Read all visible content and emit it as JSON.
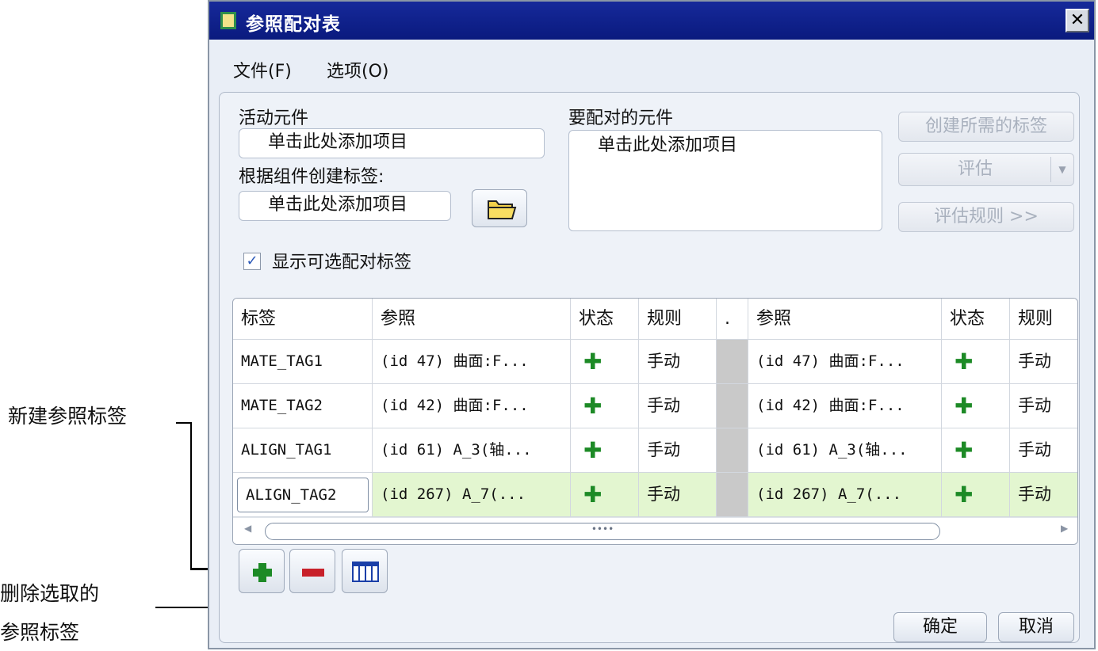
{
  "annotations": {
    "new_tag": "新建参照标签",
    "delete_line1": "删除选取的",
    "delete_line2": "参照标签"
  },
  "dialog": {
    "title": "参照配对表",
    "close_glyph": "✕"
  },
  "menu": {
    "file": "文件(F)",
    "options": "选项(O)"
  },
  "form": {
    "active_component_label": "活动元件",
    "active_component_placeholder": "单击此处添加项目",
    "by_component_label": "根据组件创建标签:",
    "by_component_placeholder": "单击此处添加项目",
    "to_pair_label": "要配对的元件",
    "to_pair_placeholder": "单击此处添加项目",
    "show_optional_label": "显示可选配对标签",
    "show_optional_checked": true
  },
  "side_buttons": {
    "create_tags": "创建所需的标签",
    "evaluate": "评估",
    "evaluate_rules": "评估规则 >>"
  },
  "table": {
    "headers": [
      "标签",
      "参照",
      "状态",
      "规则",
      ".",
      "参照",
      "状态",
      "规则"
    ],
    "rows": [
      {
        "tag": "MATE_TAG1",
        "ref1": "(id 47) 曲面:F...",
        "state1": "✚",
        "rule1": "手动",
        "ref2": "(id 47) 曲面:F...",
        "state2": "✚",
        "rule2": "手动"
      },
      {
        "tag": "MATE_TAG2",
        "ref1": "(id 42) 曲面:F...",
        "state1": "✚",
        "rule1": "手动",
        "ref2": "(id 42) 曲面:F...",
        "state2": "✚",
        "rule2": "手动"
      },
      {
        "tag": "ALIGN_TAG1",
        "ref1": "(id 61) A_3(轴...",
        "state1": "✚",
        "rule1": "手动",
        "ref2": "(id 61) A_3(轴...",
        "state2": "✚",
        "rule2": "手动"
      },
      {
        "tag": "ALIGN_TAG2",
        "ref1": "(id 267) A_7(...",
        "state1": "✚",
        "rule1": "手动",
        "ref2": "(id 267) A_7(...",
        "state2": "✚",
        "rule2": "手动"
      }
    ],
    "scroll_grip": "••••"
  },
  "footer": {
    "ok": "确定",
    "cancel": "取消"
  },
  "colors": {
    "titlebar": "#0e1f8c",
    "selected_row": "#e3f6d0",
    "status_green": "#1d8a26",
    "delete_red": "#c8202a"
  },
  "icons": {
    "title": "table-window-icon",
    "folder": "folder-icon",
    "add": "add-green-plus-icon",
    "delete": "delete-red-minus-icon",
    "columns": "table-columns-icon"
  }
}
